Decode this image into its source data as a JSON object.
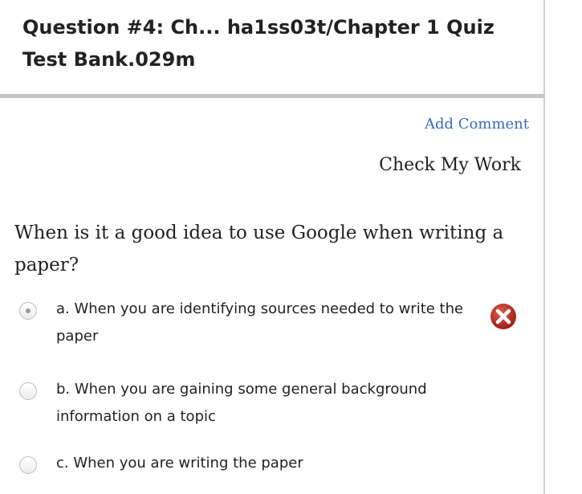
{
  "header": {
    "title": "Question #4: Ch... ha1ss03t/Chapter 1 Quiz Test Bank.029m"
  },
  "actions": {
    "add_comment": "Add Comment",
    "check_my_work": "Check My Work"
  },
  "question": {
    "text": "When is it a good idea to use Google when writing a paper?",
    "options": [
      {
        "label": "a. When you are identifying sources needed to write the paper",
        "selected": true,
        "status": "incorrect",
        "status_icon": "x-circle-icon"
      },
      {
        "label": "b. When you are gaining some general background information on a topic",
        "selected": false
      },
      {
        "label": "c. When you are writing the paper",
        "selected": false
      }
    ]
  },
  "colors": {
    "link": "#3a6bb8",
    "incorrect": "#b5322a",
    "divider": "#c4c4c4"
  }
}
